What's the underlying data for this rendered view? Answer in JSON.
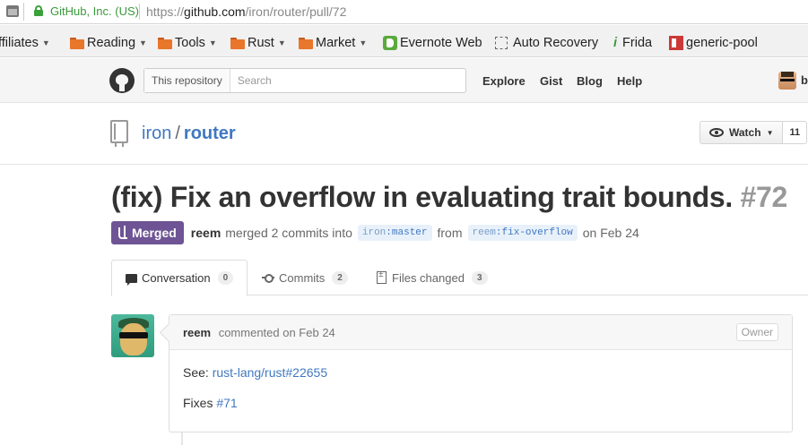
{
  "browser": {
    "ev_label": "GitHub, Inc. (US)",
    "url_scheme": "https://",
    "url_host": "github.com",
    "url_path": "/iron/router/pull/72"
  },
  "bookmarks": [
    {
      "label": "ffiliates",
      "icon": "none",
      "has_menu": true
    },
    {
      "label": "Reading",
      "icon": "folder-icon",
      "has_menu": true
    },
    {
      "label": "Tools",
      "icon": "folder-icon",
      "has_menu": true
    },
    {
      "label": "Rust",
      "icon": "folder-icon",
      "has_menu": true
    },
    {
      "label": "Market",
      "icon": "folder-icon",
      "has_menu": true
    },
    {
      "label": "Evernote Web",
      "icon": "evernote-icon",
      "has_menu": false
    },
    {
      "label": "Auto Recovery",
      "icon": "dashed-box-icon",
      "has_menu": false
    },
    {
      "label": "Frida",
      "icon": "frida-icon",
      "has_menu": false
    },
    {
      "label": "generic-pool",
      "icon": "npm-icon",
      "has_menu": false
    }
  ],
  "header": {
    "search_scope": "This repository",
    "search_placeholder": "Search",
    "nav": [
      "Explore",
      "Gist",
      "Blog",
      "Help"
    ],
    "user_initial": "b"
  },
  "repo": {
    "owner": "iron",
    "separator": "/",
    "name": "router",
    "watch_label": "Watch",
    "watch_count": "11"
  },
  "pr": {
    "title": "(fix) Fix an overflow in evaluating trait bounds.",
    "number": "#72",
    "state": "Merged",
    "author": "reem",
    "merge_text": "merged 2 commits into",
    "base_repo": "iron",
    "base_branch": "master",
    "from_text": "from",
    "head_repo": "reem",
    "head_branch": "fix-overflow",
    "date_text": "on Feb 24"
  },
  "tabs": [
    {
      "label": "Conversation",
      "count": "0",
      "selected": true
    },
    {
      "label": "Commits",
      "count": "2",
      "selected": false
    },
    {
      "label": "Files changed",
      "count": "3",
      "selected": false
    }
  ],
  "comment": {
    "author": "reem",
    "meta": "commented on Feb 24",
    "badge": "Owner",
    "line1_prefix": "See:",
    "line1_link": "rust-lang/rust#22655",
    "line2_prefix": "Fixes",
    "line2_link": "#71"
  },
  "colors": {
    "link": "#4078c0",
    "merged": "#6e5494",
    "ev_green": "#3a9a3a"
  }
}
